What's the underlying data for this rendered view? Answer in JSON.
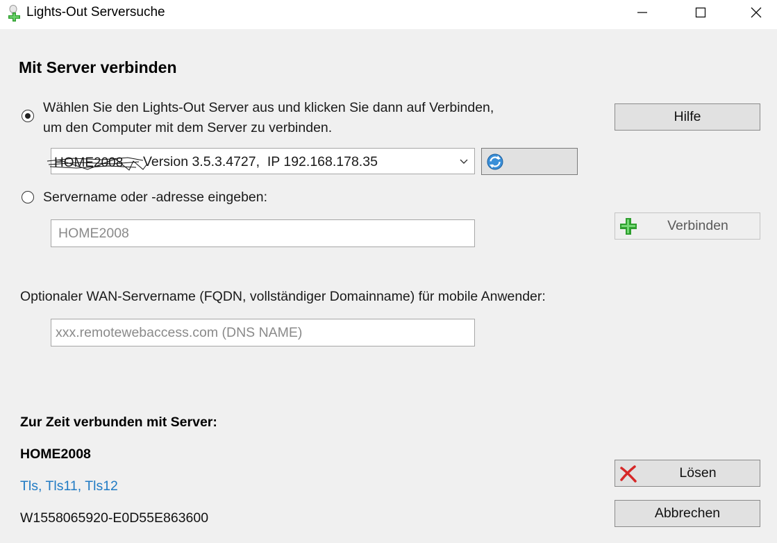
{
  "window": {
    "title": "Lights-Out Serversuche",
    "app_icon": "lights-out-plus-icon"
  },
  "heading": "Mit Server verbinden",
  "option_select": {
    "selected": true,
    "label": "Wählen Sie den Lights-Out Server aus und klicken Sie dann auf Verbinden, um den Computer mit dem Server zu verbinden."
  },
  "server_combo": {
    "value": "Version 3.5.3.4727,  IP 192.168.178.35",
    "redacted_name": "HOME2008",
    "arrow_icon": "chevron-down-icon"
  },
  "refresh_button": {
    "icon": "refresh-icon"
  },
  "option_manual": {
    "selected": false,
    "label": "Servername oder -adresse eingeben:"
  },
  "server_input": {
    "placeholder": "HOME2008"
  },
  "wan": {
    "label": "Optionaler WAN-Servername (FQDN, vollständiger Domainname)  für mobile Anwender:",
    "placeholder": "xxx.remotewebaccess.com (DNS NAME)"
  },
  "buttons": {
    "help": "Hilfe",
    "connect": "Verbinden",
    "disconnect": "Lösen",
    "cancel": "Abbrechen"
  },
  "status": {
    "heading": "Zur Zeit verbunden mit Server:",
    "server": "HOME2008",
    "protocols": "Tls, Tls11, Tls12",
    "id": "W1558065920-E0D55E863600"
  },
  "colors": {
    "background": "#f0f0f0",
    "link_blue": "#1f7ac4",
    "plus_green": "#2e9e2e",
    "cross_red": "#d62828"
  }
}
